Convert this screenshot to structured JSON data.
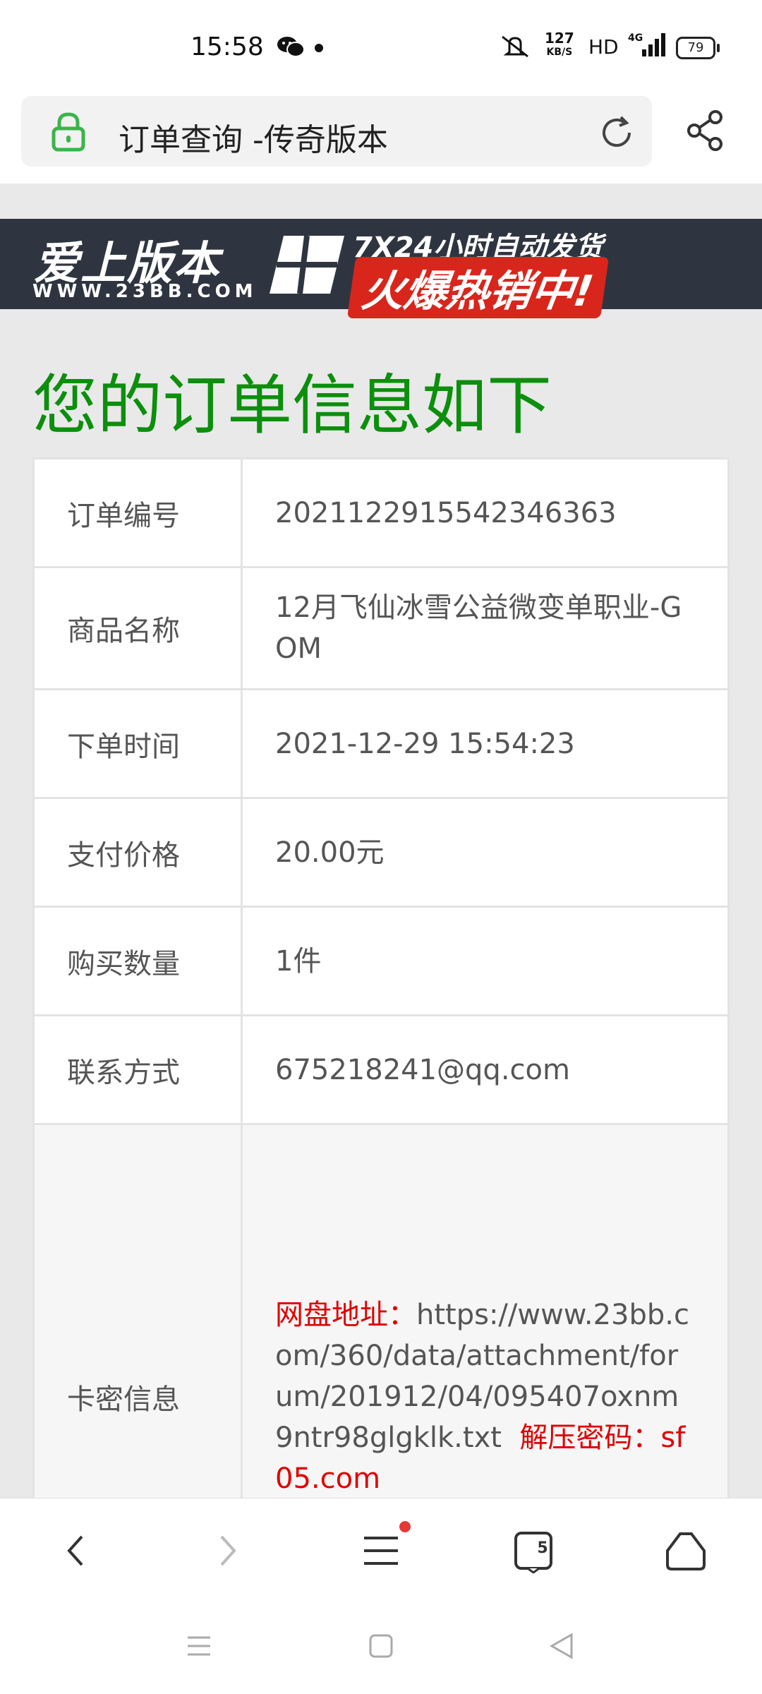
{
  "status_bar": {
    "time": "15:58",
    "speed_value": "127",
    "speed_unit": "KB/S",
    "hd": "HD",
    "battery": "79",
    "icons": [
      "wechat-icon",
      "mute-icon",
      "signal-4g-icon",
      "battery-icon"
    ]
  },
  "browser": {
    "page_title": "订单查询 -传奇版本",
    "icons": [
      "lock-icon",
      "reload-icon",
      "share-icon"
    ],
    "tab_count": "5"
  },
  "banner": {
    "brand": "爱上版本",
    "brand_url": "WWW.23BB.COM",
    "promo_line1": "7X24小时自动发货",
    "promo_line2": "火爆热销中!"
  },
  "heading": "您的订单信息如下",
  "order": {
    "order_no_label": "订单编号",
    "order_no": "2021122915542346363",
    "product_label": "商品名称",
    "product": "12月飞仙冰雪公益微变单职业-GOM",
    "time_label": "下单时间",
    "time": "2021-12-29 15:54:23",
    "price_label": "支付价格",
    "price": "20.00元",
    "qty_label": "购买数量",
    "qty": "1件",
    "contact_label": "联系方式",
    "contact": "675218241@qq.com",
    "card_label": "卡密信息",
    "card_url_label": "网盘地址：",
    "card_url": "https://www.23bb.com/360/data/attachment/forum/201912/04/095407oxnm9ntr98glgklk.txt",
    "card_pw_label": "解压密码：",
    "card_pw": "sf05.com"
  },
  "colors": {
    "heading_green": "#0c8f0c",
    "highlight_red": "#e00000",
    "banner_bg": "#2f3540",
    "page_bg": "#e9e9e9"
  }
}
